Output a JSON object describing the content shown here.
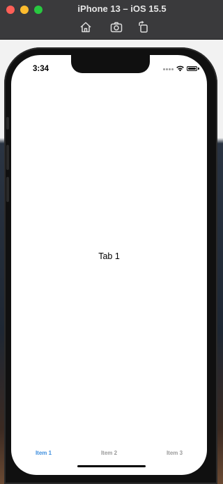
{
  "window": {
    "title": "iPhone 13 – iOS 15.5"
  },
  "toolbar": {
    "icons": [
      "home-icon",
      "screenshot-icon",
      "rotate-icon"
    ]
  },
  "status_bar": {
    "time": "3:34"
  },
  "content": {
    "label": "Tab 1"
  },
  "tab_bar": {
    "items": [
      {
        "label": "Item 1",
        "active": true
      },
      {
        "label": "Item 2",
        "active": false
      },
      {
        "label": "Item 3",
        "active": false
      }
    ]
  },
  "colors": {
    "accent": "#3d8ede",
    "inactive_tab": "#9a9a9a",
    "titlebar": "#3a3a3c"
  }
}
